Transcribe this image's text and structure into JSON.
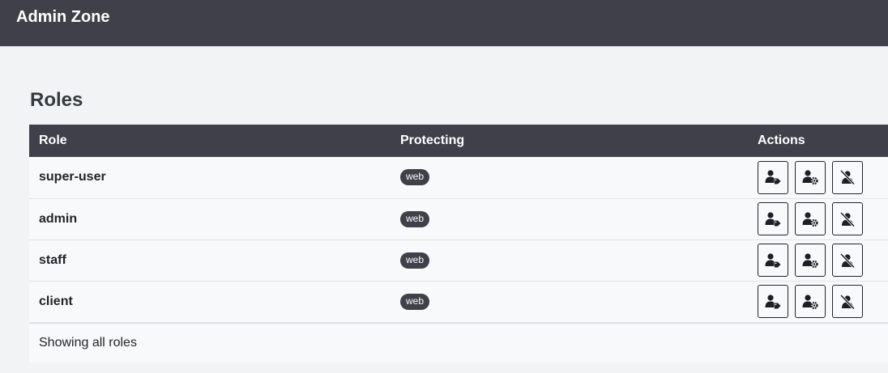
{
  "header": {
    "title": "Admin Zone"
  },
  "page": {
    "title": "Roles"
  },
  "table": {
    "columns": [
      "Role",
      "Protecting",
      "Actions"
    ],
    "rows": [
      {
        "role": "super-user",
        "guard": "web"
      },
      {
        "role": "admin",
        "guard": "web"
      },
      {
        "role": "staff",
        "guard": "web"
      },
      {
        "role": "client",
        "guard": "web"
      }
    ],
    "action_icons": [
      "user-tag-icon",
      "user-cog-icon",
      "user-slash-icon"
    ]
  },
  "footer": {
    "text": "Showing all roles"
  },
  "colors": {
    "header_bg": "#3f4049",
    "page_bg": "#f2f3f5",
    "badge_bg": "#3f4049"
  }
}
